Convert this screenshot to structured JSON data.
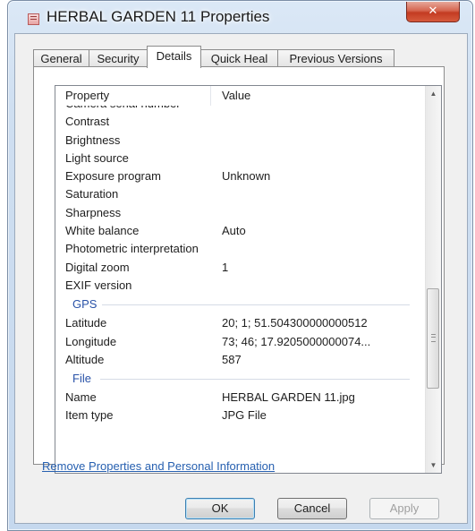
{
  "window": {
    "title": "HERBAL GARDEN 11 Properties",
    "close_label": "✕",
    "accent_close": "#c33b22"
  },
  "tabs": [
    {
      "label": "General",
      "active": false
    },
    {
      "label": "Security",
      "active": false
    },
    {
      "label": "Details",
      "active": true
    },
    {
      "label": "Quick Heal",
      "active": false
    },
    {
      "label": "Previous Versions",
      "active": false
    }
  ],
  "list": {
    "header": {
      "property": "Property",
      "value": "Value"
    },
    "rows": [
      {
        "name": "Camera serial number",
        "value": ""
      },
      {
        "name": "Contrast",
        "value": ""
      },
      {
        "name": "Brightness",
        "value": ""
      },
      {
        "name": "Light source",
        "value": ""
      },
      {
        "name": "Exposure program",
        "value": "Unknown"
      },
      {
        "name": "Saturation",
        "value": ""
      },
      {
        "name": "Sharpness",
        "value": ""
      },
      {
        "name": "White balance",
        "value": "Auto"
      },
      {
        "name": "Photometric interpretation",
        "value": ""
      },
      {
        "name": "Digital zoom",
        "value": "1"
      },
      {
        "name": "EXIF version",
        "value": ""
      }
    ],
    "groups": {
      "gps": {
        "label": "GPS",
        "rows": [
          {
            "name": "Latitude",
            "value": "20; 1; 51.504300000000512"
          },
          {
            "name": "Longitude",
            "value": "73; 46; 17.9205000000074..."
          },
          {
            "name": "Altitude",
            "value": "587"
          }
        ]
      },
      "file": {
        "label": "File",
        "rows": [
          {
            "name": "Name",
            "value": "HERBAL GARDEN 11.jpg"
          },
          {
            "name": "Item type",
            "value": "JPG File"
          }
        ]
      }
    }
  },
  "link": "Remove Properties and Personal Information",
  "buttons": {
    "ok": "OK",
    "cancel": "Cancel",
    "apply": "Apply"
  }
}
